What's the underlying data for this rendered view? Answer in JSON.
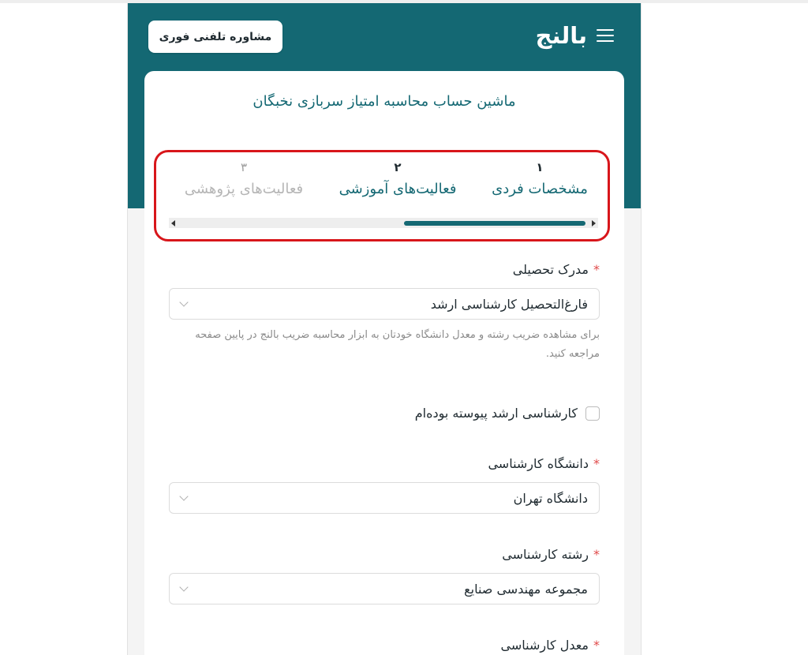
{
  "header": {
    "brand": "بالنج",
    "menu_icon": "hamburger-icon",
    "consult_button": "مشاوره تلفنی فوری"
  },
  "card": {
    "title": "ماشین حساب محاسبه امتیاز سربازی نخبگان"
  },
  "steps": [
    {
      "number": "۱",
      "label": "مشخصات فردی",
      "state": "active"
    },
    {
      "number": "۲",
      "label": "فعالیت‌های آموزشی",
      "state": "active"
    },
    {
      "number": "۳",
      "label": "فعالیت‌های پژوهشی",
      "state": "inactive"
    }
  ],
  "form": {
    "degree": {
      "label": "مدرک تحصیلی",
      "required_mark": "*",
      "value": "فارغ‌التحصیل کارشناسی ارشد",
      "hint": "برای مشاهده ضریب رشته و معدل دانشگاه خودتان به ابزار محاسبه ضریب بالنج در پایین صفحه مراجعه کنید."
    },
    "continuous_masters": {
      "label": "کارشناسی ارشد پیوسته بوده‌ام",
      "checked": false
    },
    "bachelor_university": {
      "label": "دانشگاه کارشناسی",
      "required_mark": "*",
      "value": "دانشگاه تهران"
    },
    "bachelor_major": {
      "label": "رشته کارشناسی",
      "required_mark": "*",
      "value": "مجموعه مهندسی صنایع"
    },
    "bachelor_gpa": {
      "label": "معدل کارشناسی",
      "required_mark": "*"
    }
  },
  "colors": {
    "brand_teal": "#146873",
    "highlight_border": "#d8161b",
    "required_star": "#e04a4a"
  }
}
